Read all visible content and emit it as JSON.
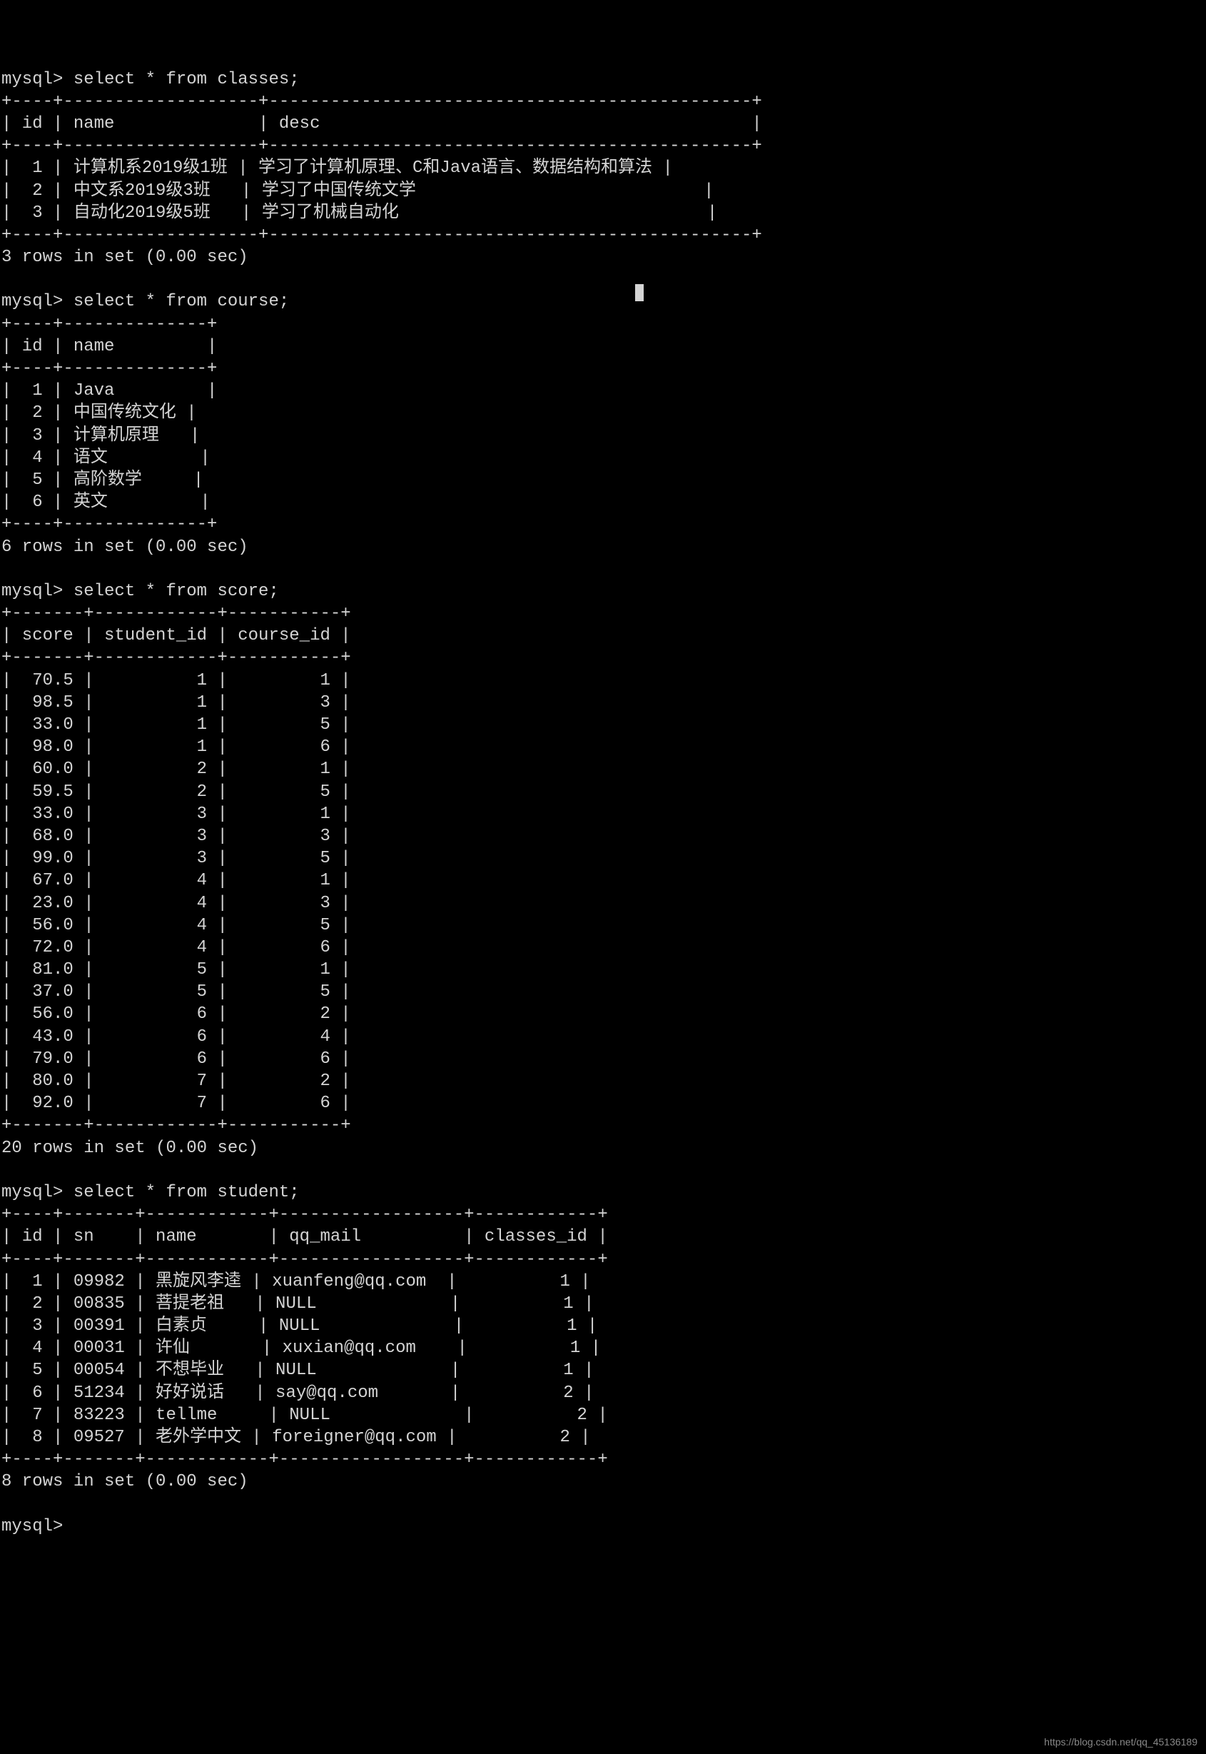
{
  "prompt": "mysql>",
  "queries": {
    "q1": "select * from classes;",
    "q2": "select * from course;",
    "q3": "select * from score;",
    "q4": "select * from student;"
  },
  "classes": {
    "headers": [
      "id",
      "name",
      "desc"
    ],
    "rows": [
      {
        "id": "1",
        "name": "计算机系2019级1班",
        "desc": "学习了计算机原理、C和Java语言、数据结构和算法"
      },
      {
        "id": "2",
        "name": "中文系2019级3班",
        "desc": "学习了中国传统文学"
      },
      {
        "id": "3",
        "name": "自动化2019级5班",
        "desc": "学习了机械自动化"
      }
    ],
    "footer": "3 rows in set (0.00 sec)"
  },
  "course": {
    "headers": [
      "id",
      "name"
    ],
    "rows": [
      {
        "id": "1",
        "name": "Java"
      },
      {
        "id": "2",
        "name": "中国传统文化"
      },
      {
        "id": "3",
        "name": "计算机原理"
      },
      {
        "id": "4",
        "name": "语文"
      },
      {
        "id": "5",
        "name": "高阶数学"
      },
      {
        "id": "6",
        "name": "英文"
      }
    ],
    "footer": "6 rows in set (0.00 sec)"
  },
  "score": {
    "headers": [
      "score",
      "student_id",
      "course_id"
    ],
    "rows": [
      {
        "score": "70.5",
        "student_id": "1",
        "course_id": "1"
      },
      {
        "score": "98.5",
        "student_id": "1",
        "course_id": "3"
      },
      {
        "score": "33.0",
        "student_id": "1",
        "course_id": "5"
      },
      {
        "score": "98.0",
        "student_id": "1",
        "course_id": "6"
      },
      {
        "score": "60.0",
        "student_id": "2",
        "course_id": "1"
      },
      {
        "score": "59.5",
        "student_id": "2",
        "course_id": "5"
      },
      {
        "score": "33.0",
        "student_id": "3",
        "course_id": "1"
      },
      {
        "score": "68.0",
        "student_id": "3",
        "course_id": "3"
      },
      {
        "score": "99.0",
        "student_id": "3",
        "course_id": "5"
      },
      {
        "score": "67.0",
        "student_id": "4",
        "course_id": "1"
      },
      {
        "score": "23.0",
        "student_id": "4",
        "course_id": "3"
      },
      {
        "score": "56.0",
        "student_id": "4",
        "course_id": "5"
      },
      {
        "score": "72.0",
        "student_id": "4",
        "course_id": "6"
      },
      {
        "score": "81.0",
        "student_id": "5",
        "course_id": "1"
      },
      {
        "score": "37.0",
        "student_id": "5",
        "course_id": "5"
      },
      {
        "score": "56.0",
        "student_id": "6",
        "course_id": "2"
      },
      {
        "score": "43.0",
        "student_id": "6",
        "course_id": "4"
      },
      {
        "score": "79.0",
        "student_id": "6",
        "course_id": "6"
      },
      {
        "score": "80.0",
        "student_id": "7",
        "course_id": "2"
      },
      {
        "score": "92.0",
        "student_id": "7",
        "course_id": "6"
      }
    ],
    "footer": "20 rows in set (0.00 sec)"
  },
  "student": {
    "headers": [
      "id",
      "sn",
      "name",
      "qq_mail",
      "classes_id"
    ],
    "rows": [
      {
        "id": "1",
        "sn": "09982",
        "name": "黑旋风李逵",
        "qq_mail": "xuanfeng@qq.com",
        "classes_id": "1"
      },
      {
        "id": "2",
        "sn": "00835",
        "name": "菩提老祖",
        "qq_mail": "NULL",
        "classes_id": "1"
      },
      {
        "id": "3",
        "sn": "00391",
        "name": "白素贞",
        "qq_mail": "NULL",
        "classes_id": "1"
      },
      {
        "id": "4",
        "sn": "00031",
        "name": "许仙",
        "qq_mail": "xuxian@qq.com",
        "classes_id": "1"
      },
      {
        "id": "5",
        "sn": "00054",
        "name": "不想毕业",
        "qq_mail": "NULL",
        "classes_id": "1"
      },
      {
        "id": "6",
        "sn": "51234",
        "name": "好好说话",
        "qq_mail": "say@qq.com",
        "classes_id": "2"
      },
      {
        "id": "7",
        "sn": "83223",
        "name": "tellme",
        "qq_mail": "NULL",
        "classes_id": "2"
      },
      {
        "id": "8",
        "sn": "09527",
        "name": "老外学中文",
        "qq_mail": "foreigner@qq.com",
        "classes_id": "2"
      }
    ],
    "footer": "8 rows in set (0.00 sec)"
  },
  "watermark": "https://blog.csdn.net/qq_45136189"
}
